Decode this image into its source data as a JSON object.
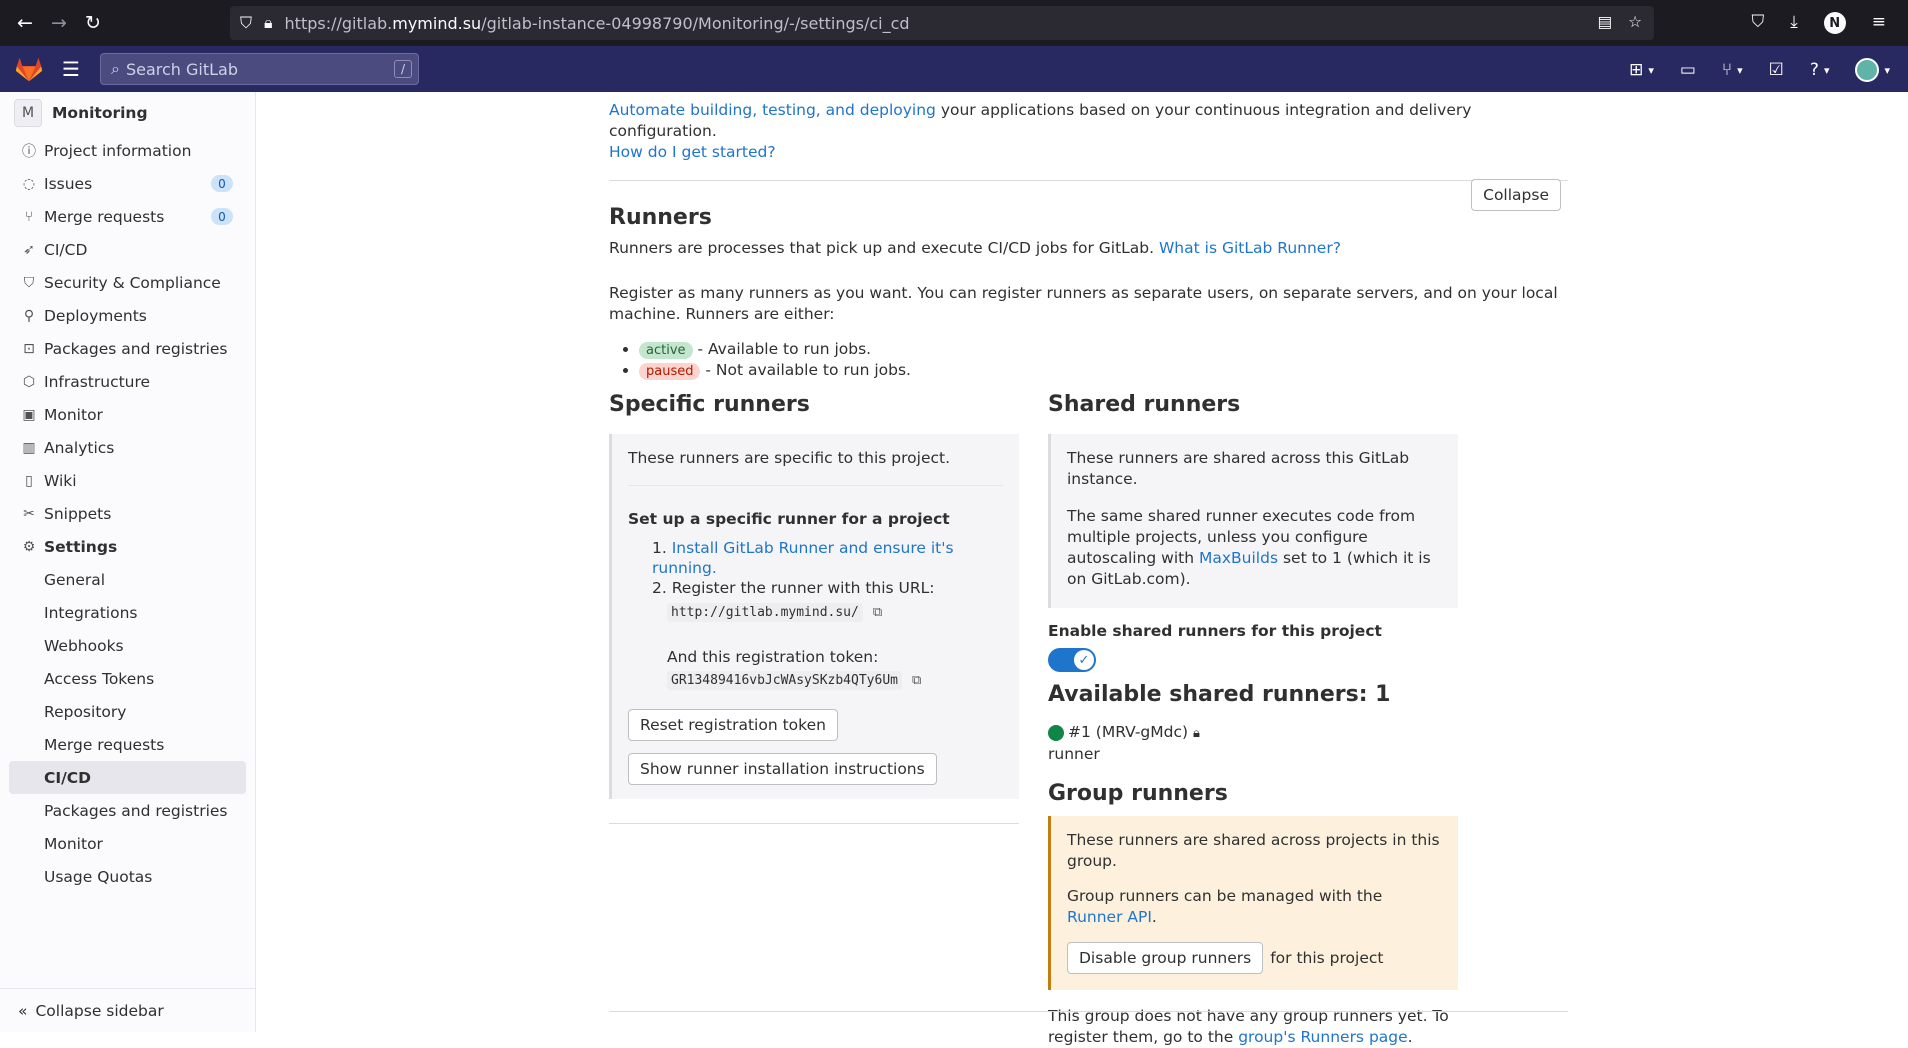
{
  "browser": {
    "url_prefix": "https://gitlab.",
    "url_domain": "mymind.su",
    "url_suffix": "/gitlab-instance-04998790/Monitoring/-/settings/ci_cd",
    "profile_initial": "N"
  },
  "topbar": {
    "search_placeholder": "Search GitLab",
    "search_shortcut": "/"
  },
  "sidebar": {
    "project_initial": "M",
    "project_name": "Monitoring",
    "items": [
      {
        "label": "Project information",
        "icon": "info-icon"
      },
      {
        "label": "Issues",
        "count": "0",
        "icon": "issues-icon"
      },
      {
        "label": "Merge requests",
        "count": "0",
        "icon": "merge-request-icon"
      },
      {
        "label": "CI/CD",
        "icon": "rocket-icon"
      },
      {
        "label": "Security & Compliance",
        "icon": "shield-icon"
      },
      {
        "label": "Deployments",
        "icon": "deployments-icon"
      },
      {
        "label": "Packages and registries",
        "icon": "package-icon"
      },
      {
        "label": "Infrastructure",
        "icon": "infrastructure-icon"
      },
      {
        "label": "Monitor",
        "icon": "monitor-icon"
      },
      {
        "label": "Analytics",
        "icon": "chart-icon"
      },
      {
        "label": "Wiki",
        "icon": "book-icon"
      },
      {
        "label": "Snippets",
        "icon": "scissors-icon"
      },
      {
        "label": "Settings",
        "icon": "gear-icon"
      }
    ],
    "settings_sub": [
      "General",
      "Integrations",
      "Webhooks",
      "Access Tokens",
      "Repository",
      "Merge requests",
      "CI/CD",
      "Packages and registries",
      "Monitor",
      "Usage Quotas"
    ],
    "collapse_label": "Collapse sidebar"
  },
  "intro": {
    "link": "Automate building, testing, and deploying",
    "text": " your applications based on your continuous integration and delivery configuration.",
    "started_link": "How do I get started?"
  },
  "runners": {
    "title": "Runners",
    "collapse": "Collapse",
    "desc": "Runners are processes that pick up and execute CI/CD jobs for GitLab. ",
    "desc_link": "What is GitLab Runner?",
    "register": "Register as many runners as you want. You can register runners as separate users, on separate servers, and on your local machine. Runners are either:",
    "active_badge": "active",
    "active_text": " - Available to run jobs.",
    "paused_badge": "paused",
    "paused_text": " - Not available to run jobs."
  },
  "specific": {
    "title": "Specific runners",
    "desc": "These runners are specific to this project.",
    "setup_title": "Set up a specific runner for a project",
    "step1": "Install GitLab Runner and ensure it's running.",
    "step2": "Register the runner with this URL:",
    "url": "http://gitlab.mymind.su/",
    "token_label": "And this registration token:",
    "token": "GR13489416vbJcWAsySKzb4QTy6Um",
    "reset_btn": "Reset registration token",
    "show_btn": "Show runner installation instructions"
  },
  "shared": {
    "title": "Shared runners",
    "desc1": "These runners are shared across this GitLab instance.",
    "desc2a": "The same shared runner executes code from multiple projects, unless you configure autoscaling with ",
    "desc2_link": "MaxBuilds",
    "desc2b": " set to 1 (which it is on GitLab.com).",
    "enable_label": "Enable shared runners for this project",
    "enabled": true,
    "available_title": "Available shared runners: 1",
    "runner_name": "#1 (MRV-gMdc)",
    "runner_tag": "runner",
    "status_color": "#108548"
  },
  "group": {
    "title": "Group runners",
    "desc1": "These runners are shared across projects in this group.",
    "desc2a": "Group runners can be managed with the ",
    "desc2_link": "Runner API",
    "desc2b": ".",
    "disable_btn": "Disable group runners",
    "for_project": "for this project",
    "none_a": "This group does not have any group runners yet. To register them, go to the ",
    "none_link": "group's Runners page",
    "none_b": "."
  }
}
